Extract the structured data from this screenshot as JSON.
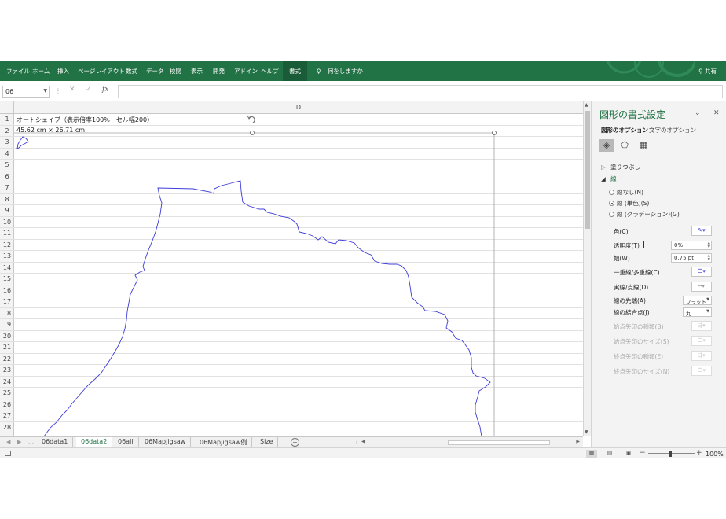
{
  "ribbon": {
    "tabs": [
      {
        "label": "ファイル",
        "active": false
      },
      {
        "label": "ホーム",
        "active": false
      },
      {
        "label": "挿入",
        "active": false
      },
      {
        "label": "ページレイアウト",
        "active": false
      },
      {
        "label": "数式",
        "active": false
      },
      {
        "label": "データ",
        "active": false
      },
      {
        "label": "校閲",
        "active": false
      },
      {
        "label": "表示",
        "active": false
      },
      {
        "label": "開発",
        "active": false
      },
      {
        "label": "アドイン",
        "active": false
      },
      {
        "label": "ヘルプ",
        "active": false
      },
      {
        "label": "書式",
        "active": true
      }
    ],
    "tell_me": "何をしますか",
    "share": "共有",
    "accent_color": "#217346"
  },
  "formula_bar": {
    "name_box": "06",
    "formula": ""
  },
  "sheet": {
    "column_header": "D",
    "rows": [
      "1",
      "2",
      "3",
      "4",
      "5",
      "6",
      "7",
      "8",
      "9",
      "10",
      "11",
      "12",
      "13",
      "14",
      "15",
      "16",
      "17",
      "18",
      "19",
      "20",
      "21",
      "22",
      "23",
      "24",
      "25",
      "26",
      "27",
      "28",
      "29"
    ],
    "cell_d1": "オートシェイプ（表示倍率100%　セル幅200）",
    "cell_d2": "45.62 cm × 26.71 cm"
  },
  "sheet_tabs": {
    "tabs": [
      {
        "label": "06data1",
        "active": false
      },
      {
        "label": "06data2",
        "active": true
      },
      {
        "label": "06all",
        "active": false
      },
      {
        "label": "06MapJigsaw",
        "active": false
      },
      {
        "label": "06MapJigsaw例",
        "active": false
      },
      {
        "label": "Size",
        "active": false
      }
    ]
  },
  "status_bar": {
    "zoom": "100%"
  },
  "format_pane": {
    "title": "図形の書式設定",
    "tabs": [
      "図形のオプション",
      "文字のオプション"
    ],
    "sections": {
      "fill": "塗りつぶし",
      "line": "線"
    },
    "line_options": [
      {
        "label": "線なし(N)",
        "selected": false
      },
      {
        "label": "線 (単色)(S)",
        "selected": true
      },
      {
        "label": "線 (グラデーション)(G)",
        "selected": false
      }
    ],
    "props": {
      "color": "色(C)",
      "transparency": "透明度(T)",
      "transparency_value": "0%",
      "width": "幅(W)",
      "width_value": "0.75 pt",
      "compound": "一重線/多重線(C)",
      "dash": "実線/点線(D)",
      "cap": "線の先端(A)",
      "cap_value": "フラット",
      "join": "線の結合点(J)",
      "join_value": "丸",
      "begin_arrow_type": "始点矢印の種類(B)",
      "begin_arrow_size": "始点矢印のサイズ(S)",
      "end_arrow_type": "終点矢印の種類(E)",
      "end_arrow_size": "終点矢印のサイズ(N)"
    },
    "shape_line_color": "#3c3cd8"
  }
}
